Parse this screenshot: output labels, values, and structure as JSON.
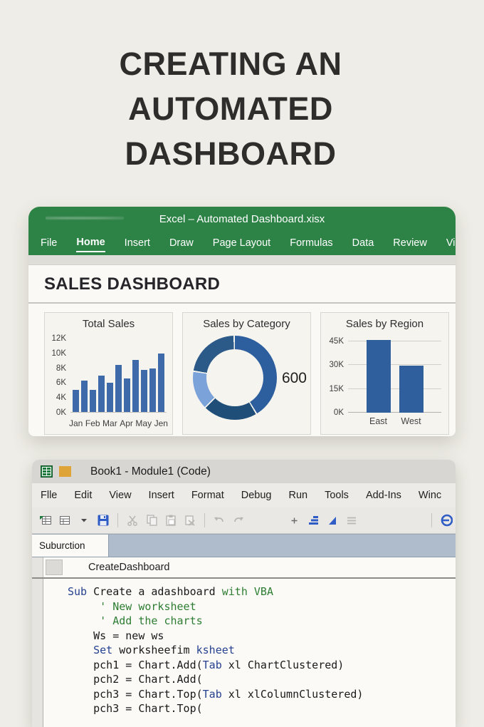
{
  "poster": {
    "title_lines": [
      "CREATING AN",
      "AUTOMATED",
      "DASHBOARD"
    ]
  },
  "excel_window": {
    "titlebar": "Excel – Automated Dashboard.xisx",
    "menu": {
      "items": [
        "File",
        "Home",
        "Insert",
        "Draw",
        "Page Layout",
        "Formulas",
        "Data",
        "Review",
        "Vie"
      ],
      "active": "Home"
    },
    "dashboard_heading": "SALES DASHBOARD",
    "colors": {
      "titlebar_green": "#2d8246",
      "card_bg": "#f5f4ef"
    }
  },
  "chart_data": [
    {
      "type": "bar",
      "title": "Total Sales",
      "x_labels": [
        "Jan",
        "Feb",
        "Mar",
        "Apr",
        "May",
        "Jen"
      ],
      "values_k": [
        5,
        6.3,
        5,
        7,
        6,
        8.4,
        6.6,
        9.1,
        7.7,
        7.9,
        10
      ],
      "y_ticks": [
        "0K",
        "4K",
        "6K",
        "8K",
        "10K",
        "12K"
      ],
      "y_tick_values": [
        0,
        4,
        6,
        8,
        10,
        12
      ],
      "bar_color": "#3e6aaa",
      "grid": false,
      "legend": false
    },
    {
      "type": "pie",
      "subtype": "donut",
      "title": "Sales by Category",
      "data_label": "600",
      "segments": [
        {
          "name": "segment-1",
          "deg": 148,
          "color": "#2d5f9e"
        },
        {
          "name": "segment-2",
          "deg": 74,
          "color": "#1f4e79"
        },
        {
          "name": "segment-3",
          "deg": 52,
          "color": "#7ba3d9"
        },
        {
          "name": "segment-4",
          "deg": 78,
          "color": "#2b5a88"
        }
      ],
      "gap_deg": 2,
      "legend": false
    },
    {
      "type": "bar",
      "title": "Sales by Region",
      "categories": [
        "East",
        "West"
      ],
      "values_k": [
        45,
        29
      ],
      "y_ticks": [
        "0K",
        "15K",
        "30K",
        "45K"
      ],
      "y_tick_values": [
        0,
        15,
        30,
        45
      ],
      "ylim": [
        0,
        45
      ],
      "bar_color": "#305f9e",
      "grid": true,
      "legend": false
    }
  ],
  "vba_window": {
    "titlebar": "Book1 - Module1 (Code)",
    "titlebar_icons": [
      "excel-sheet-icon",
      "orange-square-icon"
    ],
    "menu": {
      "items": [
        "Flle",
        "Edit",
        "View",
        "Insert",
        "Format",
        "Debug",
        "Run",
        "Tools",
        "Add-Ins",
        "Winc"
      ]
    },
    "toolbar_icons": [
      "view-excel-icon",
      "insert-module-icon",
      "dropdown-caret-icon",
      "save-icon",
      "separator",
      "cut-icon",
      "copy-icon",
      "paste-icon",
      "clear-icon",
      "separator",
      "undo-icon",
      "redo-icon",
      "spacer",
      "plus-icon",
      "indent-icon",
      "run-icon",
      "list-icon",
      "separator-right",
      "design-mode-icon"
    ],
    "proc_box": "Suburction",
    "declaration": "CreateDashboard",
    "code_lines": [
      [
        {
          "t": "Sub",
          "c": "kw"
        },
        {
          "t": " Create a adashboard ",
          "c": "txt"
        },
        {
          "t": "with VBA",
          "c": "cmt"
        }
      ],
      [
        {
          "t": "     ",
          "c": "txt"
        },
        {
          "t": "' New worksheet",
          "c": "cmt"
        }
      ],
      [
        {
          "t": "     ",
          "c": "txt"
        },
        {
          "t": "' Add the charts",
          "c": "cmt"
        }
      ],
      [
        {
          "t": "    Ws = new ws",
          "c": "txt"
        }
      ],
      [
        {
          "t": "    ",
          "c": "txt"
        },
        {
          "t": "Set",
          "c": "kw"
        },
        {
          "t": " worksheefim ",
          "c": "txt"
        },
        {
          "t": "ksheet",
          "c": "kw"
        }
      ],
      [
        {
          "t": "    pch1 = Chart.Add(",
          "c": "txt"
        },
        {
          "t": "Tab",
          "c": "kw"
        },
        {
          "t": " xl ChartClustered)",
          "c": "txt"
        }
      ],
      [
        {
          "t": "    pch2 = Chart.Add(",
          "c": "txt"
        }
      ],
      [
        {
          "t": "    pch3 = Chart.Top(",
          "c": "txt"
        },
        {
          "t": "Tab",
          "c": "kw"
        },
        {
          "t": " xl xlColumnClustered)",
          "c": "txt"
        }
      ],
      [
        {
          "t": "    pch3 = Chart.Top(",
          "c": "txt"
        }
      ]
    ]
  }
}
